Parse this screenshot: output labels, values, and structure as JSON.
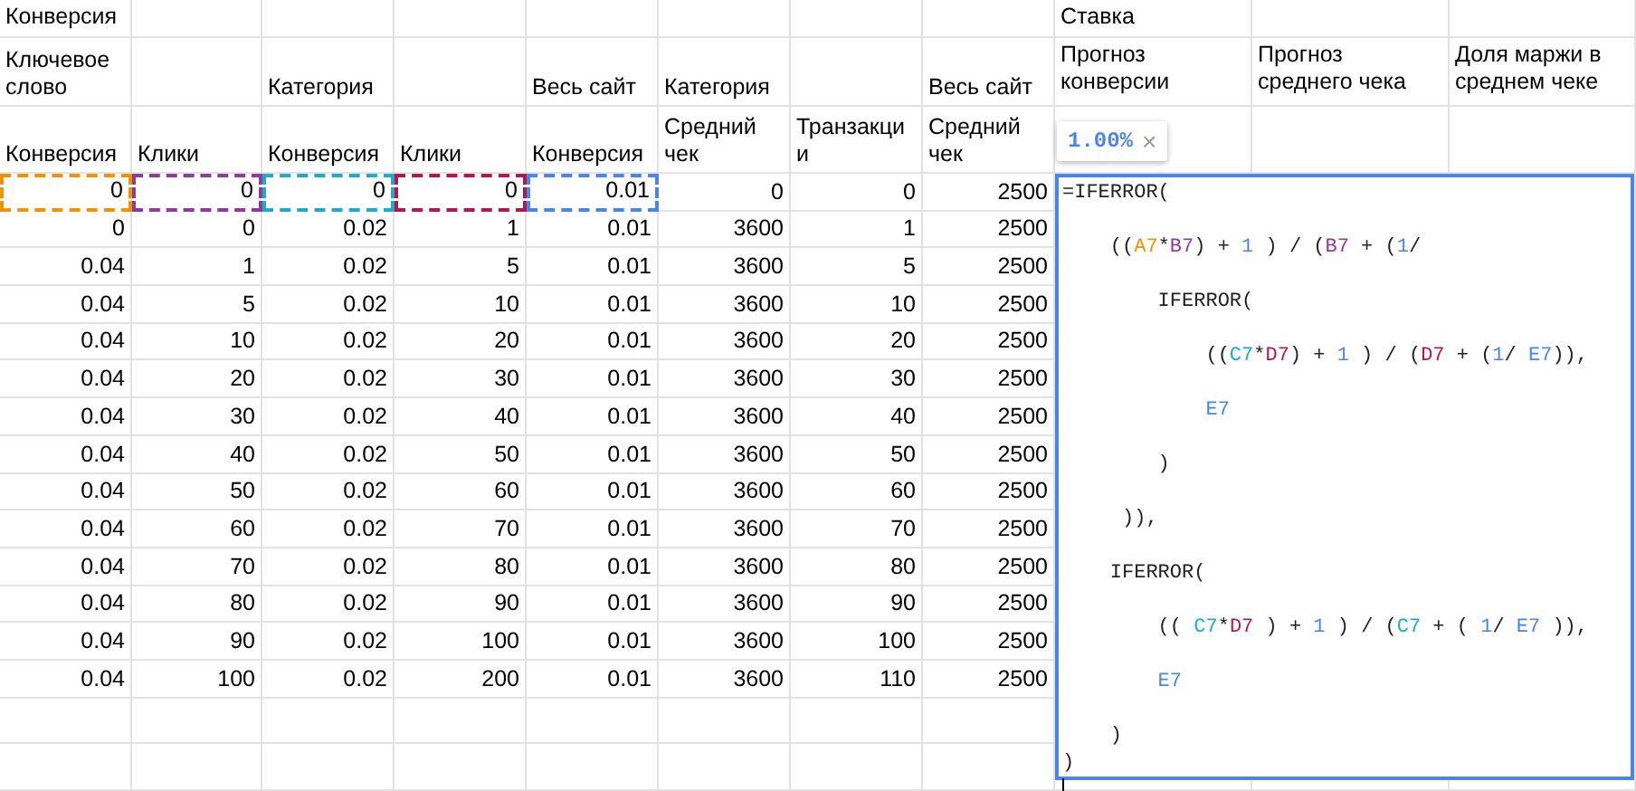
{
  "header_rows": [
    [
      "Конверсия",
      null,
      null,
      null,
      null,
      null,
      null,
      null,
      "Ставка",
      null,
      null
    ],
    [
      "Ключевое слово",
      null,
      "Категория",
      null,
      "Весь сайт",
      "Категория",
      null,
      "Весь сайт",
      "Прогноз конверсии",
      "Прогноз среднего чека",
      "Доля маржи в среднем чеке"
    ],
    [
      "Конверсия",
      "Клики",
      "Конверсия",
      "Клики",
      "Конверсия",
      "Средний чек",
      "Транзакции",
      "Средний чек",
      null,
      null,
      null
    ]
  ],
  "rows": [
    {
      "cells": [
        "0",
        "0",
        "0",
        "0",
        "0.01",
        "0",
        "0",
        "2500"
      ],
      "references": [
        {
          "color": "#f09300"
        },
        {
          "color": "#8e3c99"
        },
        {
          "color": "#1eaac8"
        },
        {
          "color": "#b0194f"
        },
        {
          "color": "#4a86e8"
        }
      ]
    },
    {
      "cells": [
        "0",
        "0",
        "0.02",
        "1",
        "0.01",
        "3600",
        "1",
        "2500"
      ]
    },
    {
      "cells": [
        "0.04",
        "1",
        "0.02",
        "5",
        "0.01",
        "3600",
        "5",
        "2500"
      ]
    },
    {
      "cells": [
        "0.04",
        "5",
        "0.02",
        "10",
        "0.01",
        "3600",
        "10",
        "2500"
      ]
    },
    {
      "cells": [
        "0.04",
        "10",
        "0.02",
        "20",
        "0.01",
        "3600",
        "20",
        "2500"
      ]
    },
    {
      "cells": [
        "0.04",
        "20",
        "0.02",
        "30",
        "0.01",
        "3600",
        "30",
        "2500"
      ]
    },
    {
      "cells": [
        "0.04",
        "30",
        "0.02",
        "40",
        "0.01",
        "3600",
        "40",
        "2500"
      ]
    },
    {
      "cells": [
        "0.04",
        "40",
        "0.02",
        "50",
        "0.01",
        "3600",
        "50",
        "2500"
      ]
    },
    {
      "cells": [
        "0.04",
        "50",
        "0.02",
        "60",
        "0.01",
        "3600",
        "60",
        "2500"
      ]
    },
    {
      "cells": [
        "0.04",
        "60",
        "0.02",
        "70",
        "0.01",
        "3600",
        "70",
        "2500"
      ]
    },
    {
      "cells": [
        "0.04",
        "70",
        "0.02",
        "80",
        "0.01",
        "3600",
        "80",
        "2500"
      ]
    },
    {
      "cells": [
        "0.04",
        "80",
        "0.02",
        "90",
        "0.01",
        "3600",
        "90",
        "2500"
      ]
    },
    {
      "cells": [
        "0.04",
        "90",
        "0.02",
        "100",
        "0.01",
        "3600",
        "100",
        "2500"
      ]
    },
    {
      "cells": [
        "0.04",
        "100",
        "0.02",
        "200",
        "0.01",
        "3600",
        "110",
        "2500"
      ]
    }
  ],
  "value_tooltip": {
    "value": "1.00%",
    "close": "×"
  },
  "formula_editor": {
    "lines": [
      {
        "tight": false,
        "segments": [
          {
            "text": "=IFERROR("
          }
        ]
      },
      {
        "tight": false,
        "segments": [
          {
            "text": "    (("
          },
          {
            "text": "A7",
            "color": "#f09300"
          },
          {
            "text": "*"
          },
          {
            "text": "B7",
            "color": "#8e3c99"
          },
          {
            "text": ") + "
          },
          {
            "text": "1",
            "color": "#4a86e8"
          },
          {
            "text": " ) / ("
          },
          {
            "text": "B7",
            "color": "#8e3c99"
          },
          {
            "text": " + ("
          },
          {
            "text": "1",
            "color": "#4a86e8"
          },
          {
            "text": "/"
          }
        ]
      },
      {
        "tight": false,
        "segments": [
          {
            "text": "        IFERROR("
          }
        ]
      },
      {
        "tight": false,
        "segments": [
          {
            "text": "            (("
          },
          {
            "text": "C7",
            "color": "#1eaac8"
          },
          {
            "text": "*"
          },
          {
            "text": "D7",
            "color": "#b0194f"
          },
          {
            "text": ") + "
          },
          {
            "text": "1",
            "color": "#4a86e8"
          },
          {
            "text": " ) / ("
          },
          {
            "text": "D7",
            "color": "#b0194f"
          },
          {
            "text": " + ("
          },
          {
            "text": "1",
            "color": "#4a86e8"
          },
          {
            "text": "/ "
          },
          {
            "text": "E7",
            "color": "#4a86e8"
          },
          {
            "text": ")),"
          }
        ]
      },
      {
        "tight": false,
        "segments": [
          {
            "text": "            E7",
            "color": "#4a86e8"
          }
        ]
      },
      {
        "tight": false,
        "segments": [
          {
            "text": "        )"
          }
        ]
      },
      {
        "tight": false,
        "segments": [
          {
            "text": "     )),"
          }
        ]
      },
      {
        "tight": false,
        "segments": [
          {
            "text": "    IFERROR("
          }
        ]
      },
      {
        "tight": false,
        "segments": [
          {
            "text": "        (( "
          },
          {
            "text": "C7",
            "color": "#1eaac8"
          },
          {
            "text": "*"
          },
          {
            "text": "D7",
            "color": "#b0194f"
          },
          {
            "text": " ) + "
          },
          {
            "text": "1",
            "color": "#4a86e8"
          },
          {
            "text": " ) / ("
          },
          {
            "text": "C7",
            "color": "#1eaac8"
          },
          {
            "text": " + ( "
          },
          {
            "text": "1",
            "color": "#4a86e8"
          },
          {
            "text": "/ "
          },
          {
            "text": "E7",
            "color": "#4a86e8"
          },
          {
            "text": " )),"
          }
        ]
      },
      {
        "tight": false,
        "segments": [
          {
            "text": "        E7",
            "color": "#4a86e8"
          }
        ]
      },
      {
        "tight": true,
        "segments": [
          {
            "text": "    )"
          }
        ]
      },
      {
        "tight": true,
        "segments": [
          {
            "text": ")"
          }
        ]
      }
    ]
  }
}
